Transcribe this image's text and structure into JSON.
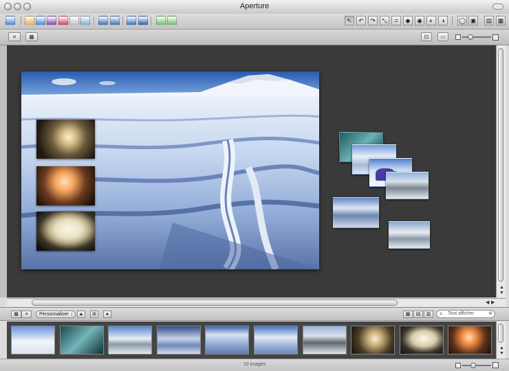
{
  "window": {
    "title": "Aperture"
  },
  "toolbar": {
    "buttons": [
      {
        "icon": "import-icon",
        "color": "#4d7fd4"
      },
      {
        "icon": "new-project-icon",
        "color": "#e0b54a"
      },
      {
        "icon": "new-album-icon",
        "color": "#4f86d9"
      },
      {
        "icon": "new-smart-album-icon",
        "color": "#8a3fb0"
      },
      {
        "icon": "new-light-table-icon",
        "color": "#d43e5a"
      },
      {
        "icon": "new-book-icon",
        "color": "#c4c4c4"
      },
      {
        "icon": "new-web-gallery-icon",
        "color": "#7ab0d8"
      },
      {
        "icon": "stack-icon",
        "color": "#3f6fb6"
      },
      {
        "icon": "unstack-icon",
        "color": "#3f6fb6"
      },
      {
        "icon": "compare-icon",
        "color": "#3c73c2"
      },
      {
        "icon": "loupe-mode-icon",
        "color": "#2e5fae"
      },
      {
        "icon": "rotate-left-icon",
        "color": "#6fbf6b"
      },
      {
        "icon": "rotate-right-icon",
        "color": "#6fbf6b"
      }
    ],
    "tools": [
      {
        "icon": "selection-tool-icon",
        "glyph": "↖"
      },
      {
        "icon": "rotate-left-tool-icon",
        "glyph": "↶"
      },
      {
        "icon": "rotate-right-tool-icon",
        "glyph": "↷"
      },
      {
        "icon": "straighten-tool-icon",
        "glyph": "⤡"
      },
      {
        "icon": "crop-tool-icon",
        "glyph": "⌗"
      },
      {
        "icon": "redeye-tool-icon",
        "glyph": "◆"
      },
      {
        "icon": "spot-patch-tool-icon",
        "glyph": "◉"
      },
      {
        "icon": "lift-tool-icon",
        "glyph": "◐"
      },
      {
        "icon": "stamp-tool-icon",
        "glyph": "◑"
      }
    ],
    "right": [
      {
        "icon": "loupe-icon",
        "glyph": "◯"
      },
      {
        "icon": "full-screen-icon",
        "glyph": "▣"
      },
      {
        "icon": "inspector-icon",
        "glyph": "▤"
      },
      {
        "icon": "hud-icon",
        "glyph": "▦"
      }
    ]
  },
  "secondbar": {
    "left": [
      {
        "icon": "list-view-icon",
        "glyph": "≡"
      },
      {
        "icon": "info-icon",
        "glyph": "▦"
      }
    ],
    "right": [
      {
        "icon": "zoom-fit-icon",
        "glyph": "⊡"
      },
      {
        "icon": "actual-size-icon",
        "glyph": "▭"
      }
    ],
    "zoom": 0.2
  },
  "browser": {
    "view_buttons": [
      {
        "icon": "grid-view-icon",
        "glyph": "▦"
      },
      {
        "icon": "list-view-icon",
        "glyph": "≡"
      }
    ],
    "sort_popup": "Personnaliser",
    "sort_buttons": [
      {
        "icon": "sort-ascending-icon",
        "glyph": "▲"
      },
      {
        "icon": "filter-icon",
        "glyph": "⊞"
      },
      {
        "icon": "lock-icon",
        "glyph": "●"
      }
    ],
    "right_buttons": [
      {
        "icon": "filmstrip-view-icon",
        "glyph": "▦"
      },
      {
        "icon": "split-view-icon",
        "glyph": "▤"
      },
      {
        "icon": "viewer-toggle-icon",
        "glyph": "▥"
      }
    ],
    "search_placeholder": "Tout afficher",
    "search_icon": "search-icon",
    "thumbnails": [
      {
        "name": "penguin-diver",
        "bg": "linear-gradient(180deg,#6b93dd,#f1f5fb 55%,#d8e2ee)"
      },
      {
        "name": "ice-cave",
        "bg": "linear-gradient(135deg,#1b4b55,#73b5b9 50%,#0f2f36)"
      },
      {
        "name": "mountains-snow",
        "bg": "linear-gradient(180deg,#5a84cc,#e9eef5 45%,#8c9aa7 65%,#e3e8ee)"
      },
      {
        "name": "sea-ice-sunset",
        "bg": "linear-gradient(180deg,#344f86,#c6d3e8 45%,#6f89ba 70%,#d7dfec)"
      },
      {
        "name": "cracked-ice",
        "bg": "linear-gradient(180deg,#3964b1,#d6e1f1 30%,#8aa4d0 70%,#5e78ac)"
      },
      {
        "name": "ice-field",
        "bg": "linear-gradient(180deg,#4774c3,#e4ebf6 40%,#9bb4dd 70%,#6d87b8)"
      },
      {
        "name": "penguin-colony",
        "bg": "linear-gradient(180deg,#9ab4db,#d9e0e8 35%,#5f6770 60%,#e0e5ea)"
      },
      {
        "name": "sea-anemone-fan",
        "bg": "radial-gradient(circle at 55% 45%,#f6f0d8,#c7ae79 25%,#4a3c27 60%,#15110c)"
      },
      {
        "name": "sponge",
        "bg": "radial-gradient(ellipse at 55% 45%,#fbf7e8,#d9cfae 35%,#3c352a 65%,#0f0e0c)"
      },
      {
        "name": "orange-anemone",
        "bg": "radial-gradient(circle at 48% 40%,#ffe0b8,#f08f45 25%,#5e311a 60%,#150d08)"
      }
    ]
  },
  "status": {
    "count_label": "10 images"
  }
}
